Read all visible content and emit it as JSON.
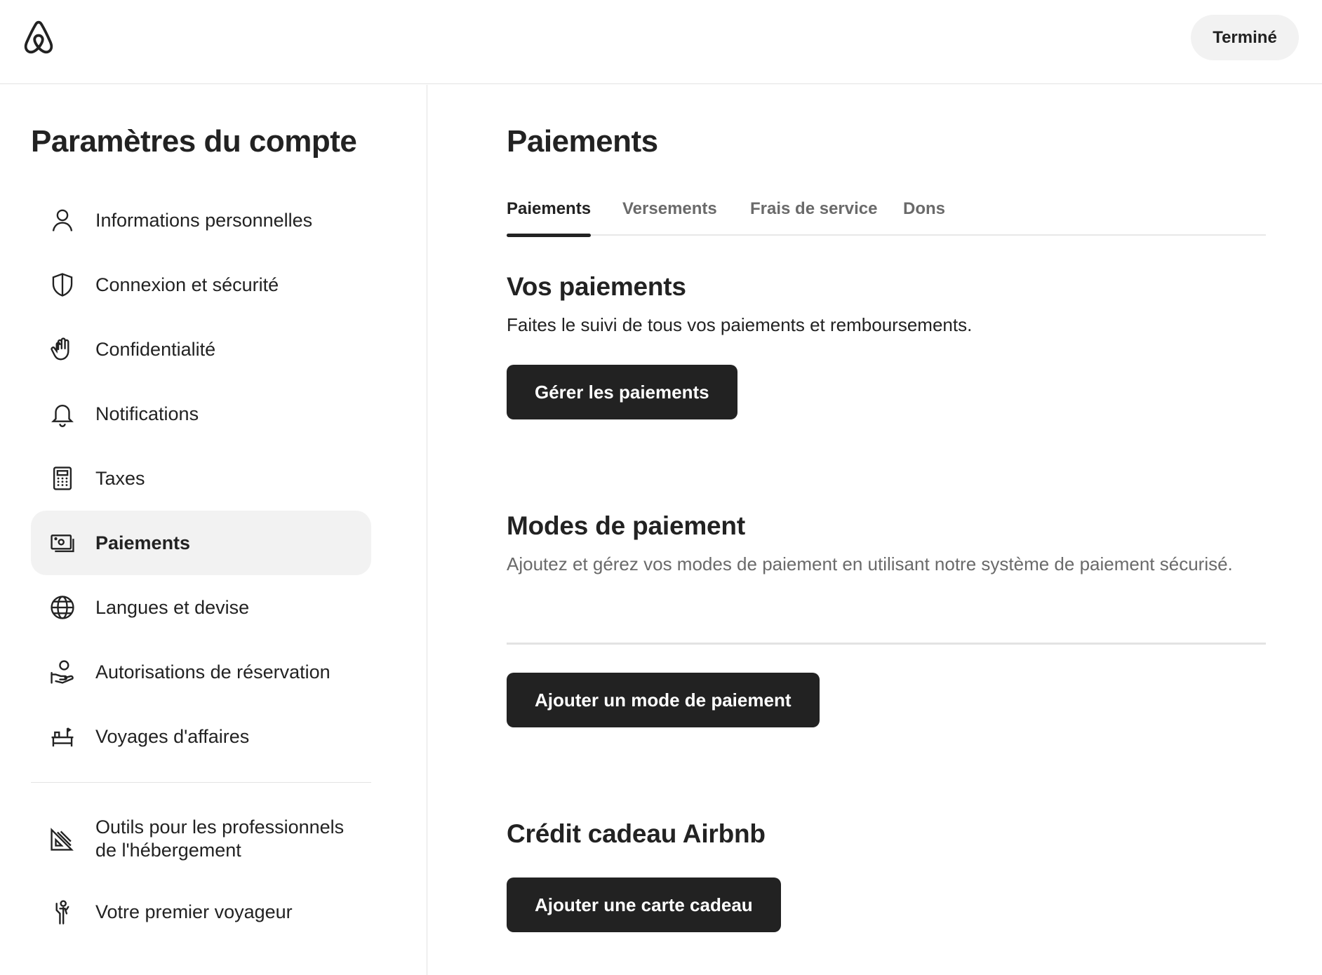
{
  "header": {
    "logo_icon": "airbnb-logo-icon",
    "done_label": "Terminé"
  },
  "sidebar": {
    "title": "Paramètres du compte",
    "items": [
      {
        "label": "Informations personnelles",
        "icon": "person-icon"
      },
      {
        "label": "Connexion et sécurité",
        "icon": "shield-icon"
      },
      {
        "label": "Confidentialité",
        "icon": "hand-icon"
      },
      {
        "label": "Notifications",
        "icon": "bell-icon"
      },
      {
        "label": "Taxes",
        "icon": "calculator-icon"
      },
      {
        "label": "Paiements",
        "icon": "banknote-icon",
        "active": true
      },
      {
        "label": "Langues et devise",
        "icon": "globe-icon"
      },
      {
        "label": "Autorisations de réservation",
        "icon": "hand-coins-icon"
      },
      {
        "label": "Voyages d'affaires",
        "icon": "desk-icon"
      }
    ],
    "secondary_items": [
      {
        "label": "Outils pour les professionnels de l'hébergement",
        "icon": "drafting-tools-icon"
      },
      {
        "label": "Votre premier voyageur",
        "icon": "person-waving-icon"
      }
    ]
  },
  "main": {
    "title": "Paiements",
    "tabs": [
      {
        "label": "Paiements",
        "active": true
      },
      {
        "label": "Versements"
      },
      {
        "label": "Frais de service"
      },
      {
        "label": "Dons"
      }
    ],
    "your_payments": {
      "title": "Vos paiements",
      "description": "Faites le suivi de tous vos paiements et remboursements.",
      "button_label": "Gérer les paiements"
    },
    "payment_methods": {
      "title": "Modes de paiement",
      "description": "Ajoutez et gérez vos modes de paiement en utilisant notre système de paiement sécurisé.",
      "button_label": "Ajouter un mode de paiement"
    },
    "gift_credit": {
      "title": "Crédit cadeau Airbnb",
      "button_label": "Ajouter une carte cadeau"
    }
  },
  "colors": {
    "text": "#222222",
    "muted": "#6a6a6a",
    "button_dark": "#222222",
    "pill_bg": "#f2f2f2",
    "divider": "#e3e3e3"
  }
}
